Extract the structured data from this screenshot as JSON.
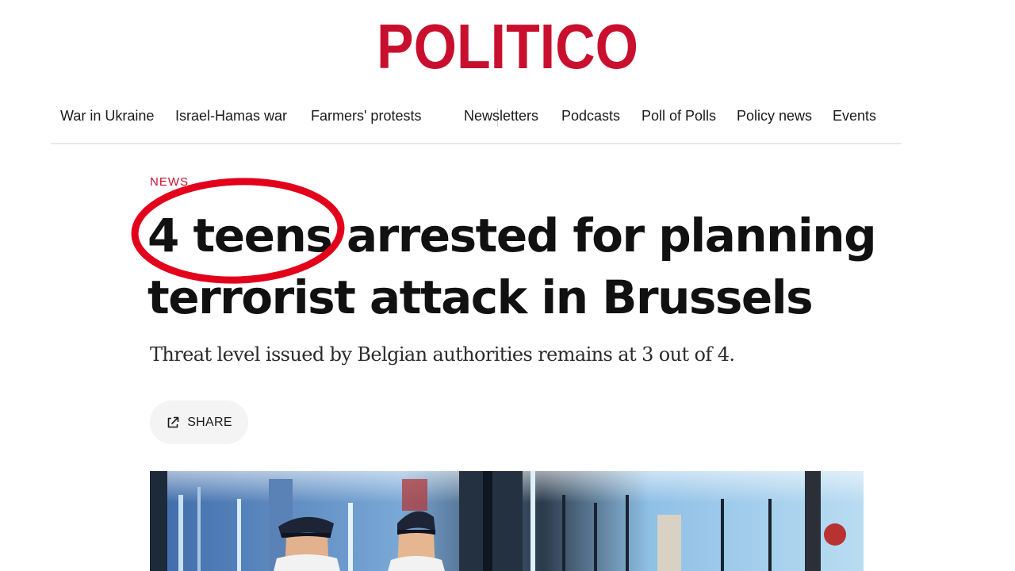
{
  "brand": {
    "logo_text": "POLITICO",
    "logo_color": "#c8102e"
  },
  "nav": {
    "items": [
      {
        "label": "War in Ukraine"
      },
      {
        "label": "Israel-Hamas war"
      },
      {
        "label": "Farmers' protests"
      },
      {
        "label": "Newsletters"
      },
      {
        "label": "Podcasts"
      },
      {
        "label": "Poll of Polls"
      },
      {
        "label": "Policy news"
      },
      {
        "label": "Events"
      }
    ]
  },
  "article": {
    "section": "NEWS",
    "headline_line1": "4 teens arrested for planning",
    "headline_line2": "terrorist attack in Brussels",
    "subhead": "Threat level issued by Belgian authorities remains at 3 out of 4.",
    "share_label": "SHARE",
    "share_icon": "external-link-icon"
  },
  "annotation": {
    "shape": "ellipse",
    "color": "#e3001b",
    "highlights": "4 teens"
  }
}
